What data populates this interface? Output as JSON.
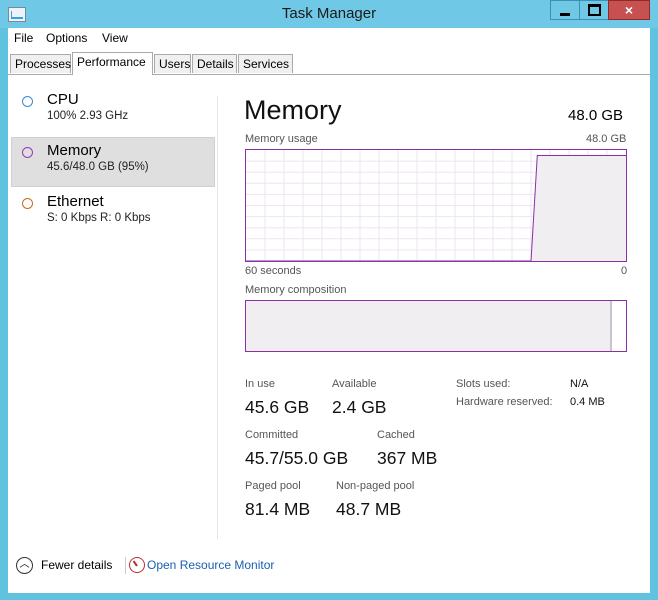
{
  "window": {
    "title": "Task Manager",
    "minimize_glyph": "minimize",
    "maximize_glyph": "maximize",
    "close_glyph": "×"
  },
  "menu": [
    "File",
    "Options",
    "View"
  ],
  "tabs": [
    "Processes",
    "Performance",
    "Users",
    "Details",
    "Services"
  ],
  "active_tab": "Performance",
  "resources": [
    {
      "name": "CPU",
      "sub": "100%  2.93 GHz",
      "color": "#3a8ad6"
    },
    {
      "name": "Memory",
      "sub": "45.6/48.0 GB (95%)",
      "color": "#9a39b5"
    },
    {
      "name": "Ethernet",
      "sub": "S: 0 Kbps  R: 0 Kbps",
      "color": "#c96b1f"
    }
  ],
  "selected_resource": "Memory",
  "memory": {
    "title": "Memory",
    "total": "48.0 GB",
    "usage_label": "Memory usage",
    "usage_max": "48.0 GB",
    "time_left": "60 seconds",
    "time_right": "0",
    "composition_label": "Memory composition",
    "usage_series": [
      0,
      0,
      0,
      0,
      0,
      0,
      0,
      0,
      0,
      0,
      0,
      0,
      0,
      0,
      0,
      0,
      0,
      0,
      0,
      0,
      0,
      0,
      0,
      0,
      0,
      0,
      0,
      0,
      0,
      0,
      0,
      0,
      0,
      0,
      0,
      0,
      0,
      0,
      0,
      0,
      0,
      0,
      0,
      0,
      0,
      0,
      45.6,
      45.6,
      45.6,
      45.6,
      45.6,
      45.6,
      45.6,
      45.6,
      45.6,
      45.6,
      45.6,
      45.6,
      45.6,
      45.6,
      45.6
    ],
    "accent": "#8b2fa6",
    "stats": {
      "in_use_label": "In use",
      "in_use": "45.6 GB",
      "available_label": "Available",
      "available": "2.4 GB",
      "committed_label": "Committed",
      "committed": "45.7/55.0 GB",
      "cached_label": "Cached",
      "cached": "367 MB",
      "paged_label": "Paged pool",
      "paged": "81.4 MB",
      "nonpaged_label": "Non-paged pool",
      "nonpaged": "48.7 MB",
      "slots_label": "Slots used:",
      "slots": "N/A",
      "hwres_label": "Hardware reserved:",
      "hwres": "0.4 MB"
    }
  },
  "footer": {
    "fewer_details": "Fewer details",
    "open_resource_monitor": "Open Resource Monitor",
    "chevron_icon": "chevron-up-icon"
  }
}
